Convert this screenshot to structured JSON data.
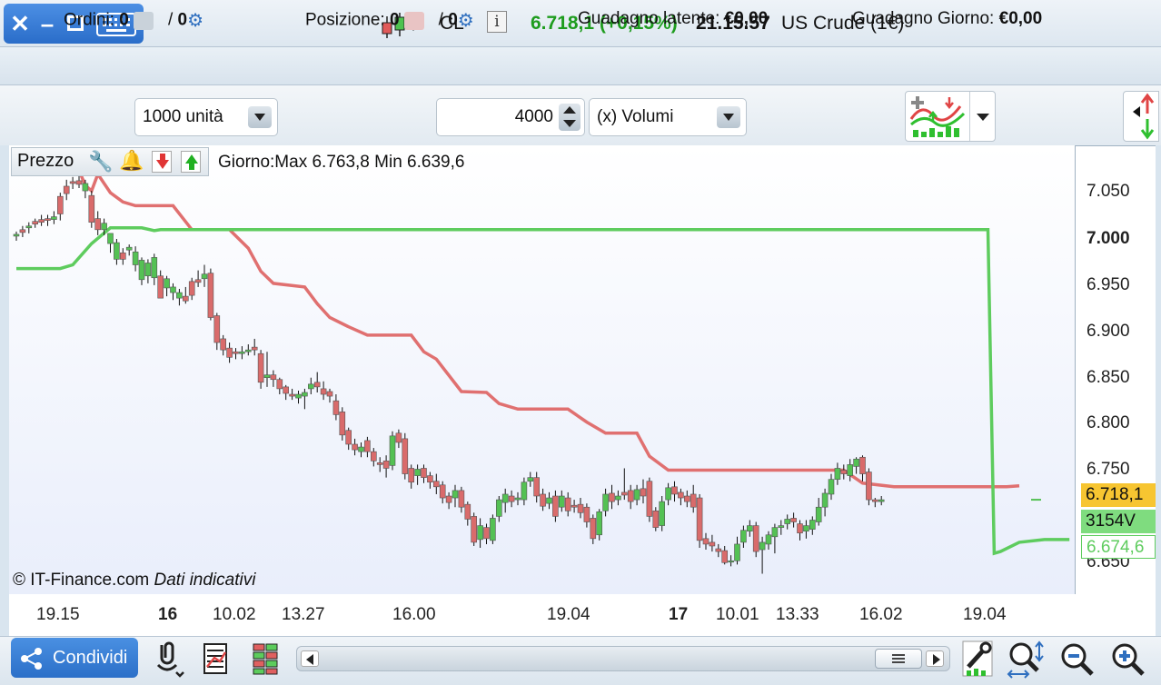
{
  "header": {
    "symbol": "CL",
    "last_price": "6.718,1",
    "change": "(+0,15%)",
    "time": "21.15.57",
    "instrument": "US Crude (1€)"
  },
  "account": {
    "orders_label": "Ordini:",
    "orders_count": "0",
    "orders_pending": "0",
    "position_label": "Posizione:",
    "position_count": "0",
    "position_pending": "0",
    "slash": "/",
    "unrealized_label": "Guadagno latente:",
    "unrealized_value": "€0,00",
    "daily_label": "Guadagno Giorno:",
    "daily_value": "€0,00"
  },
  "toolbar": {
    "units": "1000 unità",
    "bars": "4000",
    "volume_option": "(x) Volumi"
  },
  "chart_header": {
    "prezzo_label": "Prezzo",
    "day_range": "Giorno:Max 6.763,8 Min 6.639,6"
  },
  "footer_note": {
    "copyright": "© IT-Finance.com",
    "disclaimer": "Dati indicativi"
  },
  "badges": {
    "price": "6.718,1",
    "volume": "3154V",
    "indicator": "6.674,6"
  },
  "colors": {
    "up": "#54c154",
    "down": "#d96b6b",
    "resistance": "#e07070",
    "support": "#5ecc5e",
    "price_badge": "#f7c531",
    "volume_badge": "#7fdc7f"
  },
  "chart_data": {
    "type": "candlestick",
    "ylim": [
      6620,
      7080
    ],
    "y_ticks": [
      "7.050",
      "7.000",
      "6.950",
      "6.900",
      "6.850",
      "6.800",
      "6.750",
      "6.650"
    ],
    "x_ticks": [
      "19.15",
      "16",
      "10.02",
      "13.27",
      "16.00",
      "19.04",
      "17",
      "10.01",
      "13.33",
      "16.02",
      "19.04"
    ],
    "candles": [
      [
        7003,
        7005,
        6998,
        7008
      ],
      [
        7010,
        7007,
        7002,
        7014
      ],
      [
        7012,
        7014,
        7006,
        7018
      ],
      [
        7019,
        7016,
        7012,
        7022
      ],
      [
        7021,
        7018,
        7014,
        7026
      ],
      [
        7022,
        7020,
        7014,
        7026
      ],
      [
        7021,
        7024,
        7016,
        7030
      ],
      [
        7046,
        7027,
        7020,
        7050
      ],
      [
        7057,
        7049,
        7042,
        7064
      ],
      [
        7062,
        7060,
        7054,
        7067
      ],
      [
        7063,
        7059,
        7055,
        7070
      ],
      [
        7052,
        7060,
        7044,
        7064
      ],
      [
        7047,
        7018,
        7012,
        7052
      ],
      [
        7022,
        7010,
        7004,
        7030
      ],
      [
        7010,
        7017,
        7004,
        7022
      ],
      [
        6995,
        7006,
        6985,
        7000
      ],
      [
        6978,
        6996,
        6972,
        7000
      ],
      [
        6985,
        6978,
        6972,
        6990
      ],
      [
        6988,
        6991,
        6982,
        6994
      ],
      [
        6972,
        6986,
        6965,
        6992
      ],
      [
        6956,
        6977,
        6950,
        6980
      ],
      [
        6960,
        6974,
        6952,
        6978
      ],
      [
        6958,
        6980,
        6950,
        6984
      ],
      [
        6960,
        6936,
        6950,
        6966
      ],
      [
        6947,
        6957,
        6938,
        6960
      ],
      [
        6942,
        6948,
        6934,
        6952
      ],
      [
        6936,
        6942,
        6928,
        6946
      ],
      [
        6938,
        6933,
        6930,
        6948
      ],
      [
        6954,
        6939,
        6934,
        6958
      ],
      [
        6956,
        6953,
        6948,
        6966
      ],
      [
        6957,
        6962,
        6948,
        6972
      ],
      [
        6963,
        6915,
        6912,
        6968
      ],
      [
        6917,
        6888,
        6880,
        6920
      ],
      [
        6892,
        6880,
        6874,
        6896
      ],
      [
        6882,
        6872,
        6866,
        6888
      ],
      [
        6878,
        6876,
        6870,
        6882
      ],
      [
        6876,
        6878,
        6870,
        6884
      ],
      [
        6878,
        6880,
        6874,
        6886
      ],
      [
        6883,
        6880,
        6874,
        6892
      ],
      [
        6876,
        6845,
        6838,
        6880
      ],
      [
        6850,
        6853,
        6840,
        6878
      ],
      [
        6853,
        6848,
        6840,
        6858
      ],
      [
        6848,
        6838,
        6832,
        6850
      ],
      [
        6840,
        6833,
        6826,
        6842
      ],
      [
        6832,
        6830,
        6826,
        6838
      ],
      [
        6828,
        6832,
        6822,
        6836
      ],
      [
        6830,
        6834,
        6816,
        6838
      ],
      [
        6838,
        6843,
        6832,
        6850
      ],
      [
        6845,
        6840,
        6834,
        6856
      ],
      [
        6838,
        6832,
        6826,
        6846
      ],
      [
        6835,
        6830,
        6823,
        6838
      ],
      [
        6825,
        6810,
        6804,
        6832
      ],
      [
        6813,
        6788,
        6782,
        6818
      ],
      [
        6793,
        6778,
        6772,
        6796
      ],
      [
        6778,
        6772,
        6766,
        6784
      ],
      [
        6770,
        6775,
        6764,
        6780
      ],
      [
        6782,
        6770,
        6764,
        6786
      ],
      [
        6770,
        6760,
        6754,
        6774
      ],
      [
        6758,
        6756,
        6748,
        6764
      ],
      [
        6760,
        6752,
        6742,
        6766
      ],
      [
        6755,
        6787,
        6750,
        6792
      ],
      [
        6790,
        6780,
        6774,
        6794
      ],
      [
        6784,
        6746,
        6740,
        6790
      ],
      [
        6752,
        6737,
        6730,
        6756
      ],
      [
        6744,
        6751,
        6734,
        6756
      ],
      [
        6752,
        6742,
        6736,
        6756
      ],
      [
        6744,
        6737,
        6730,
        6748
      ],
      [
        6738,
        6732,
        6724,
        6746
      ],
      [
        6734,
        6720,
        6714,
        6738
      ],
      [
        6722,
        6715,
        6708,
        6726
      ],
      [
        6720,
        6728,
        6710,
        6734
      ],
      [
        6728,
        6710,
        6704,
        6732
      ],
      [
        6713,
        6697,
        6690,
        6716
      ],
      [
        6700,
        6672,
        6668,
        6704
      ],
      [
        6675,
        6690,
        6666,
        6698
      ],
      [
        6688,
        6676,
        6670,
        6692
      ],
      [
        6674,
        6698,
        6670,
        6702
      ],
      [
        6700,
        6718,
        6694,
        6722
      ],
      [
        6715,
        6724,
        6704,
        6730
      ],
      [
        6722,
        6716,
        6710,
        6728
      ],
      [
        6718,
        6720,
        6712,
        6726
      ],
      [
        6718,
        6737,
        6712,
        6742
      ],
      [
        6738,
        6742,
        6732,
        6748
      ],
      [
        6742,
        6722,
        6715,
        6748
      ],
      [
        6724,
        6711,
        6706,
        6730
      ],
      [
        6714,
        6720,
        6708,
        6726
      ],
      [
        6722,
        6700,
        6694,
        6728
      ],
      [
        6710,
        6722,
        6705,
        6728
      ],
      [
        6720,
        6706,
        6700,
        6726
      ],
      [
        6712,
        6710,
        6704,
        6718
      ],
      [
        6713,
        6704,
        6698,
        6720
      ],
      [
        6710,
        6694,
        6688,
        6714
      ],
      [
        6698,
        6676,
        6670,
        6702
      ],
      [
        6680,
        6705,
        6674,
        6708
      ],
      [
        6706,
        6724,
        6700,
        6730
      ],
      [
        6725,
        6716,
        6708,
        6734
      ],
      [
        6718,
        6722,
        6712,
        6728
      ],
      [
        6726,
        6723,
        6718,
        6752
      ],
      [
        6728,
        6716,
        6708,
        6734
      ],
      [
        6718,
        6729,
        6712,
        6734
      ],
      [
        6730,
        6722,
        6714,
        6740
      ],
      [
        6738,
        6700,
        6694,
        6742
      ],
      [
        6706,
        6688,
        6684,
        6710
      ],
      [
        6690,
        6716,
        6684,
        6722
      ],
      [
        6718,
        6731,
        6712,
        6736
      ],
      [
        6732,
        6724,
        6716,
        6738
      ],
      [
        6726,
        6720,
        6712,
        6730
      ],
      [
        6722,
        6716,
        6710,
        6728
      ],
      [
        6724,
        6710,
        6704,
        6734
      ],
      [
        6720,
        6674,
        6666,
        6724
      ],
      [
        6676,
        6670,
        6664,
        6682
      ],
      [
        6672,
        6668,
        6662,
        6680
      ],
      [
        6665,
        6662,
        6656,
        6670
      ],
      [
        6663,
        6650,
        6648,
        6668
      ],
      [
        6652,
        6652,
        6646,
        6658
      ],
      [
        6652,
        6670,
        6648,
        6678
      ],
      [
        6672,
        6685,
        6666,
        6690
      ],
      [
        6684,
        6690,
        6678,
        6696
      ],
      [
        6690,
        6662,
        6656,
        6694
      ],
      [
        6664,
        6672,
        6638,
        6678
      ],
      [
        6670,
        6680,
        6664,
        6684
      ],
      [
        6678,
        6688,
        6660,
        6692
      ],
      [
        6688,
        6690,
        6680,
        6696
      ],
      [
        6692,
        6697,
        6686,
        6702
      ],
      [
        6698,
        6694,
        6688,
        6704
      ],
      [
        6692,
        6682,
        6674,
        6696
      ],
      [
        6684,
        6690,
        6676,
        6696
      ],
      [
        6686,
        6696,
        6680,
        6700
      ],
      [
        6694,
        6710,
        6690,
        6720
      ],
      [
        6710,
        6725,
        6700,
        6730
      ],
      [
        6724,
        6740,
        6718,
        6746
      ],
      [
        6740,
        6752,
        6734,
        6758
      ],
      [
        6750,
        6746,
        6740,
        6756
      ],
      [
        6744,
        6756,
        6738,
        6762
      ],
      [
        6754,
        6762,
        6746,
        6764
      ],
      [
        6764,
        6746,
        6738,
        6766
      ],
      [
        6748,
        6718,
        6712,
        6752
      ],
      [
        6718,
        6716,
        6710,
        6720
      ],
      [
        6716,
        6718,
        6712,
        6722
      ]
    ],
    "resistance_line": [
      [
        0,
        7075
      ],
      [
        10,
        7074
      ],
      [
        11,
        7058
      ],
      [
        12,
        7052
      ],
      [
        13,
        7070
      ],
      [
        15,
        7050
      ],
      [
        17,
        7040
      ],
      [
        19,
        7036
      ],
      [
        25,
        7036
      ],
      [
        28,
        7010
      ],
      [
        34,
        7010
      ],
      [
        37,
        6990
      ],
      [
        39,
        6965
      ],
      [
        41,
        6952
      ],
      [
        46,
        6948
      ],
      [
        48,
        6930
      ],
      [
        50,
        6915
      ],
      [
        53,
        6905
      ],
      [
        56,
        6896
      ],
      [
        63,
        6896
      ],
      [
        65,
        6878
      ],
      [
        67,
        6870
      ],
      [
        71,
        6835
      ],
      [
        75,
        6834
      ],
      [
        77,
        6822
      ],
      [
        80,
        6816
      ],
      [
        88,
        6816
      ],
      [
        91,
        6802
      ],
      [
        94,
        6790
      ],
      [
        99,
        6790
      ],
      [
        101,
        6765
      ],
      [
        104,
        6750
      ],
      [
        132,
        6750
      ],
      [
        135,
        6736
      ],
      [
        140,
        6732
      ],
      [
        158,
        6732
      ],
      [
        160,
        6733
      ]
    ],
    "support_line": [
      [
        0,
        6968
      ],
      [
        7,
        6968
      ],
      [
        9,
        6972
      ],
      [
        12,
        6995
      ],
      [
        15,
        7012
      ],
      [
        20,
        7012
      ],
      [
        22,
        7009
      ],
      [
        23,
        7010
      ],
      [
        155,
        7010
      ],
      [
        156,
        6660
      ],
      [
        157,
        6662
      ],
      [
        160,
        6672
      ],
      [
        164,
        6675
      ],
      [
        168,
        6675
      ]
    ]
  }
}
